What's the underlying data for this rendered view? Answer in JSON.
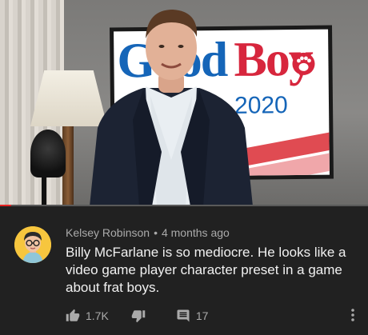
{
  "video": {
    "poster_word_1": "Good",
    "poster_word_2": "Boy",
    "poster_year": "2020",
    "progress_fraction": 0.03
  },
  "comment": {
    "author": "Kelsey Robinson",
    "separator": "•",
    "time": "4 months ago",
    "text": "Billy McFarlane is so mediocre. He looks like a video game player character preset in a game about frat boys.",
    "likes": "1.7K",
    "replies": "17"
  },
  "icons": {
    "like": "thumbs-up-icon",
    "dislike": "thumbs-down-icon",
    "reply": "reply-icon",
    "more": "more-vert-icon"
  },
  "colors": {
    "background": "#212121",
    "meta_text": "#aaaaaa",
    "body_text": "#f1f1f1",
    "progress": "#e52222",
    "avatar_bg": "#f7c63e"
  }
}
